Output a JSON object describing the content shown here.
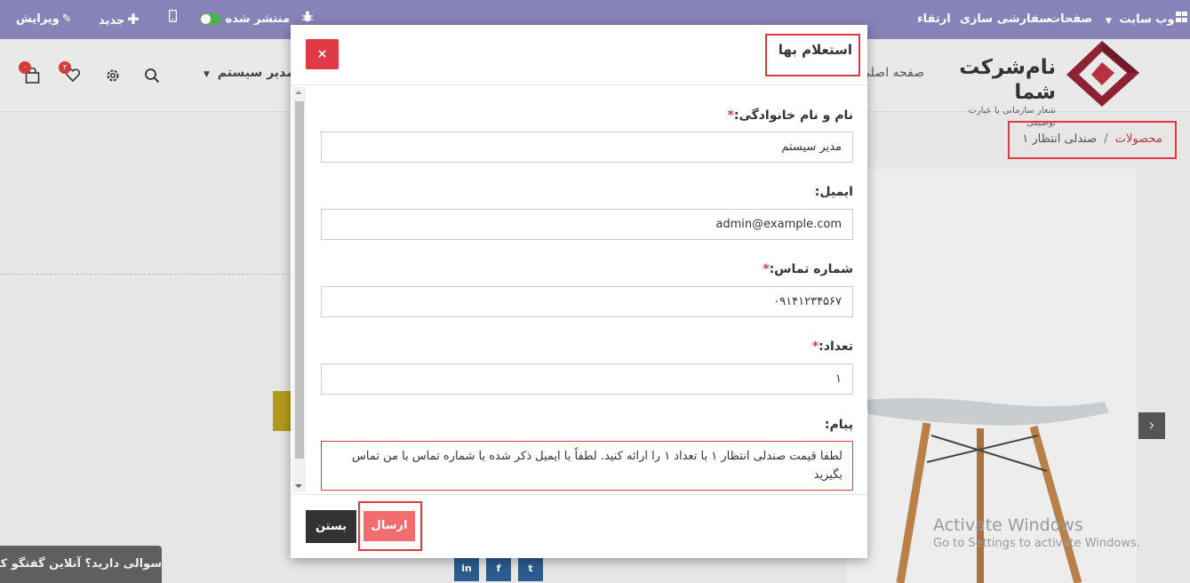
{
  "topbar": {
    "website": "وب سایت",
    "pages": "صفحات",
    "customize": "سفارشی سازی",
    "upgrade": "ارتقاء",
    "published": "منتشر شده",
    "new": "جدید",
    "edit": "ویرایش"
  },
  "header": {
    "company_name": "نام‌شرکت شما",
    "company_slogan": "شعار سازمانی یا عبارت توصیفی",
    "nav_home": "صفحه اصلی",
    "user_menu": "مدیر سیستم",
    "wishlist_count": "۳",
    "cart_count": "۰"
  },
  "breadcrumb": {
    "products": "محصولات",
    "separator": "/",
    "current": "صندلی انتظار ۱"
  },
  "modal": {
    "title": "استعلام بها",
    "close_icon": "×",
    "fields": {
      "name_label": "نام و نام خانوادگی:",
      "name_value": "مدیر سیستم",
      "email_label": "ایمیل:",
      "email_value": "admin@example.com",
      "phone_label": "شماره تماس:",
      "phone_value": "۰۹۱۴۱۲۳۴۵۶۷",
      "qty_label": "تعداد:",
      "qty_value": "۱",
      "message_label": "پیام:",
      "message_value": "لطفا قیمت صندلی انتظار ۱ با تعداد ۱ را ارائه کنید. لطفاً با ایمیل ذکر شده یا شماره تماس با من تماس بگیرید",
      "required_mark": "*"
    },
    "buttons": {
      "submit": "ارسال",
      "close": "بستن"
    }
  },
  "watermark": {
    "line1": "Activate Windows",
    "line2": "Go to Settings to activate Windows."
  },
  "chat": {
    "label": "سوالی دارید؟ آنلاین گفتگو کنید"
  },
  "social": {
    "linkedin": "in",
    "facebook": "f",
    "twitter": "t"
  },
  "colors": {
    "topbar": "#8783b9",
    "accent_red": "#e03a3e",
    "submit": "#f26d6d",
    "close_button": "#e03a47",
    "link": "#b03840"
  }
}
